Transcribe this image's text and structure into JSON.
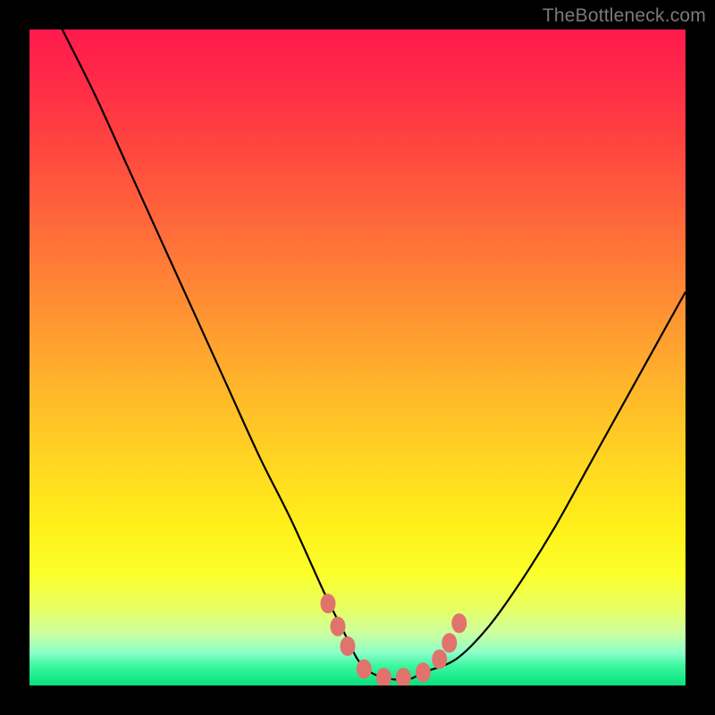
{
  "watermark": "TheBottleneck.com",
  "colors": {
    "frame_bg": "#000000",
    "curve_stroke": "#000000",
    "marker_fill": "#e0746c",
    "gradient_top": "#ff1a4d",
    "gradient_bottom": "#0edb7a"
  },
  "chart_data": {
    "type": "line",
    "title": "",
    "xlabel": "",
    "ylabel": "",
    "xlim": [
      0,
      100
    ],
    "ylim": [
      0,
      100
    ],
    "grid": false,
    "legend": false,
    "annotations": [
      "TheBottleneck.com"
    ],
    "series": [
      {
        "name": "bottleneck-curve",
        "x": [
          5,
          10,
          15,
          20,
          25,
          30,
          35,
          40,
          45,
          48,
          50,
          52,
          55,
          58,
          60,
          65,
          70,
          75,
          80,
          85,
          90,
          95,
          100
        ],
        "y": [
          100,
          90,
          79,
          68,
          57,
          46,
          35,
          25,
          14,
          8,
          4,
          2,
          1,
          1,
          2,
          4,
          9,
          16,
          24,
          33,
          42,
          51,
          60
        ]
      }
    ],
    "markers": {
      "name": "highlight-points",
      "x": [
        45.5,
        47.0,
        48.5,
        51.0,
        54.0,
        57.0,
        60.0,
        62.5,
        64.0,
        65.5
      ],
      "y": [
        12.5,
        9.0,
        6.0,
        2.5,
        1.2,
        1.2,
        2.0,
        4.0,
        6.5,
        9.5
      ]
    }
  }
}
